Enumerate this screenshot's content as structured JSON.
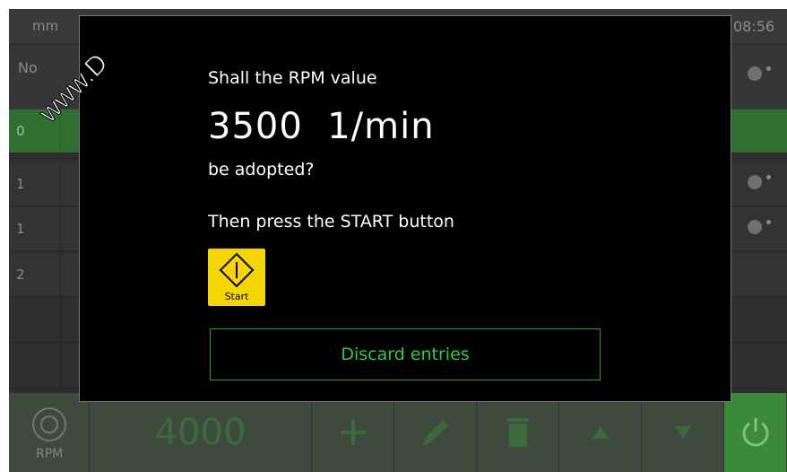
{
  "header": {
    "unit": "mm",
    "time": "08:56"
  },
  "table": {
    "col_no": "No",
    "rows": [
      {
        "index": "0",
        "active": true
      },
      {
        "index": "1",
        "active": false
      },
      {
        "index": "1",
        "active": false
      },
      {
        "index": "2",
        "active": false
      }
    ]
  },
  "toolbar": {
    "rpm_label": "RPM",
    "rpm_value": "4000",
    "buttons": [
      "add-icon",
      "pencil-icon",
      "trash-icon",
      "arrow-up-icon",
      "arrow-down-icon",
      "power-icon"
    ]
  },
  "modal": {
    "line1": "Shall the RPM value",
    "value": "3500  1/min",
    "line2": "be adopted?",
    "line3": "Then press the START button",
    "start_label": "Start",
    "discard_label": "Discard entries"
  },
  "watermark": {
    "text": "www.D"
  },
  "colors": {
    "accent_green": "#2ecc40",
    "start_yellow": "#f5d600",
    "active_row": "#2f6f31"
  }
}
